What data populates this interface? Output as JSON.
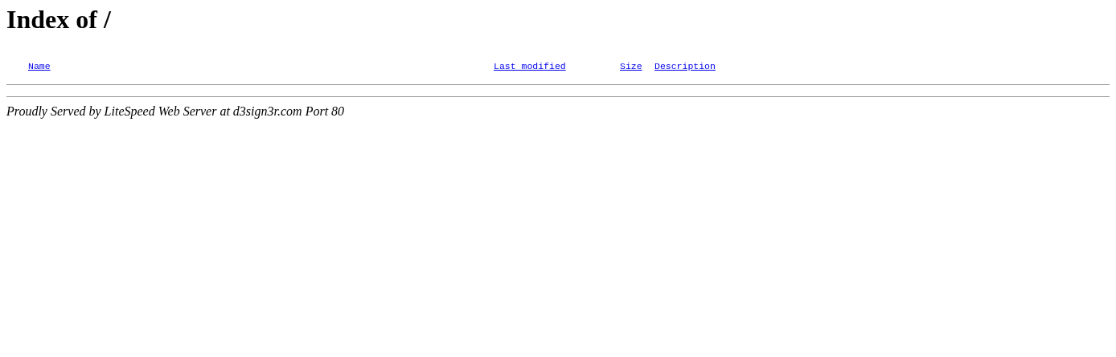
{
  "title": "Index of /",
  "columns": [
    "Name",
    "Last modified",
    "Size",
    "Description"
  ],
  "footer": "Proudly Served by LiteSpeed Web Server at d3sign3r.com Port 80"
}
